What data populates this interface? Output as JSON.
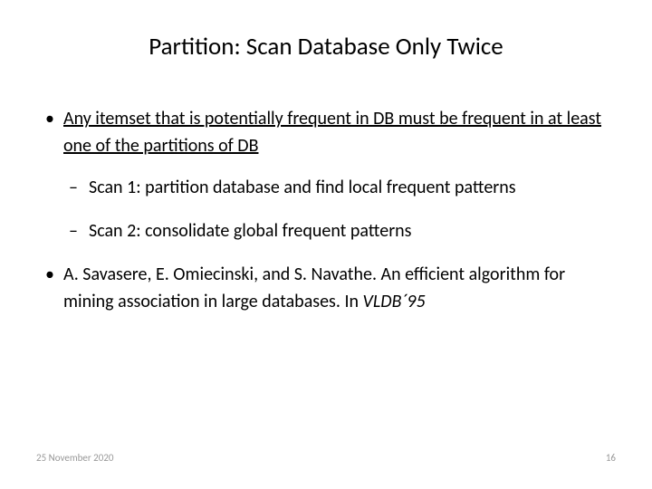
{
  "title": "Partition: Scan Database Only Twice",
  "bullets": {
    "item1_underlined": "Any itemset that is potentially frequent in DB must be frequent in at least one of the partitions of DB",
    "sub1": "Scan 1: partition database and find local frequent patterns",
    "sub2": "Scan 2: consolidate global frequent patterns",
    "item2_prefix": "A. Savasere, E. Omiecinski, and S. Navathe. ",
    "item2_mid": "An efficient algorithm for mining association in large databases. ",
    "item2_in": "In ",
    "item2_venue": "VLDB´95"
  },
  "footer": {
    "date": "25 November 2020",
    "page": "16"
  }
}
